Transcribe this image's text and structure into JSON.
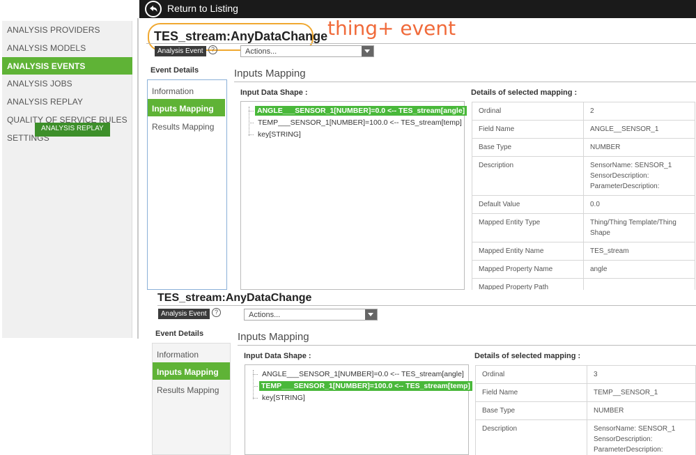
{
  "topbar": {
    "return_label": "Return to Listing"
  },
  "sidebar": {
    "items": [
      {
        "label": "ANALYSIS PROVIDERS"
      },
      {
        "label": "ANALYSIS MODELS"
      },
      {
        "label": "ANALYSIS EVENTS"
      },
      {
        "label": "ANALYSIS JOBS"
      },
      {
        "label": "ANALYSIS REPLAY"
      },
      {
        "label": "QUALITY OF SERVICE RULES"
      },
      {
        "label": "SETTINGS"
      }
    ],
    "tooltip": "ANALYSIS REPLAY"
  },
  "annotation": "thing+ event",
  "panel1": {
    "title": "TES_stream:AnyDataChange",
    "badge": "Analysis Event",
    "help": "?",
    "actions": "Actions...",
    "event_details": "Event Details",
    "tabs": [
      {
        "label": "Information"
      },
      {
        "label": "Inputs Mapping"
      },
      {
        "label": "Results Mapping"
      }
    ],
    "section": "Inputs Mapping",
    "input_shape_label": "Input Data Shape :",
    "details_label": "Details of selected mapping :",
    "tree": [
      {
        "label": "ANGLE___SENSOR_1[NUMBER]=0.0 <-- TES_stream[angle]"
      },
      {
        "label": "TEMP___SENSOR_1[NUMBER]=100.0 <-- TES_stream[temp]"
      },
      {
        "label": "key[STRING]"
      }
    ],
    "rows": [
      {
        "k": "Ordinal",
        "v": "2"
      },
      {
        "k": "Field Name",
        "v": "ANGLE__SENSOR_1"
      },
      {
        "k": "Base Type",
        "v": "NUMBER"
      },
      {
        "k": "Description",
        "v": [
          "SensorName: SENSOR_1",
          "SensorDescription:",
          "ParameterDescription:"
        ]
      },
      {
        "k": "Default Value",
        "v": "0.0"
      },
      {
        "k": "Mapped Entity Type",
        "v": [
          "Thing/Thing Template/Thing",
          "Shape"
        ]
      },
      {
        "k": "Mapped Entity Name",
        "v": "TES_stream"
      },
      {
        "k": "Mapped Property Name",
        "v": "angle"
      },
      {
        "k": "Mapped Property Path",
        "v": ""
      }
    ]
  },
  "panel2": {
    "title": "TES_stream:AnyDataChange",
    "badge": "Analysis Event",
    "help": "?",
    "actions": "Actions...",
    "event_details": "Event Details",
    "tabs": [
      {
        "label": "Information"
      },
      {
        "label": "Inputs Mapping"
      },
      {
        "label": "Results Mapping"
      }
    ],
    "section": "Inputs Mapping",
    "input_shape_label": "Input Data Shape :",
    "details_label": "Details of selected mapping :",
    "tree": [
      {
        "label": "ANGLE___SENSOR_1[NUMBER]=0.0 <-- TES_stream[angle]"
      },
      {
        "label": "TEMP___SENSOR_1[NUMBER]=100.0 <-- TES_stream[temp]"
      },
      {
        "label": "key[STRING]"
      }
    ],
    "rows": [
      {
        "k": "Ordinal",
        "v": "3"
      },
      {
        "k": "Field Name",
        "v": "TEMP__SENSOR_1"
      },
      {
        "k": "Base Type",
        "v": "NUMBER"
      },
      {
        "k": "Description",
        "v": [
          "SensorName: SENSOR_1",
          "SensorDescription:",
          "ParameterDescription:"
        ]
      }
    ]
  }
}
